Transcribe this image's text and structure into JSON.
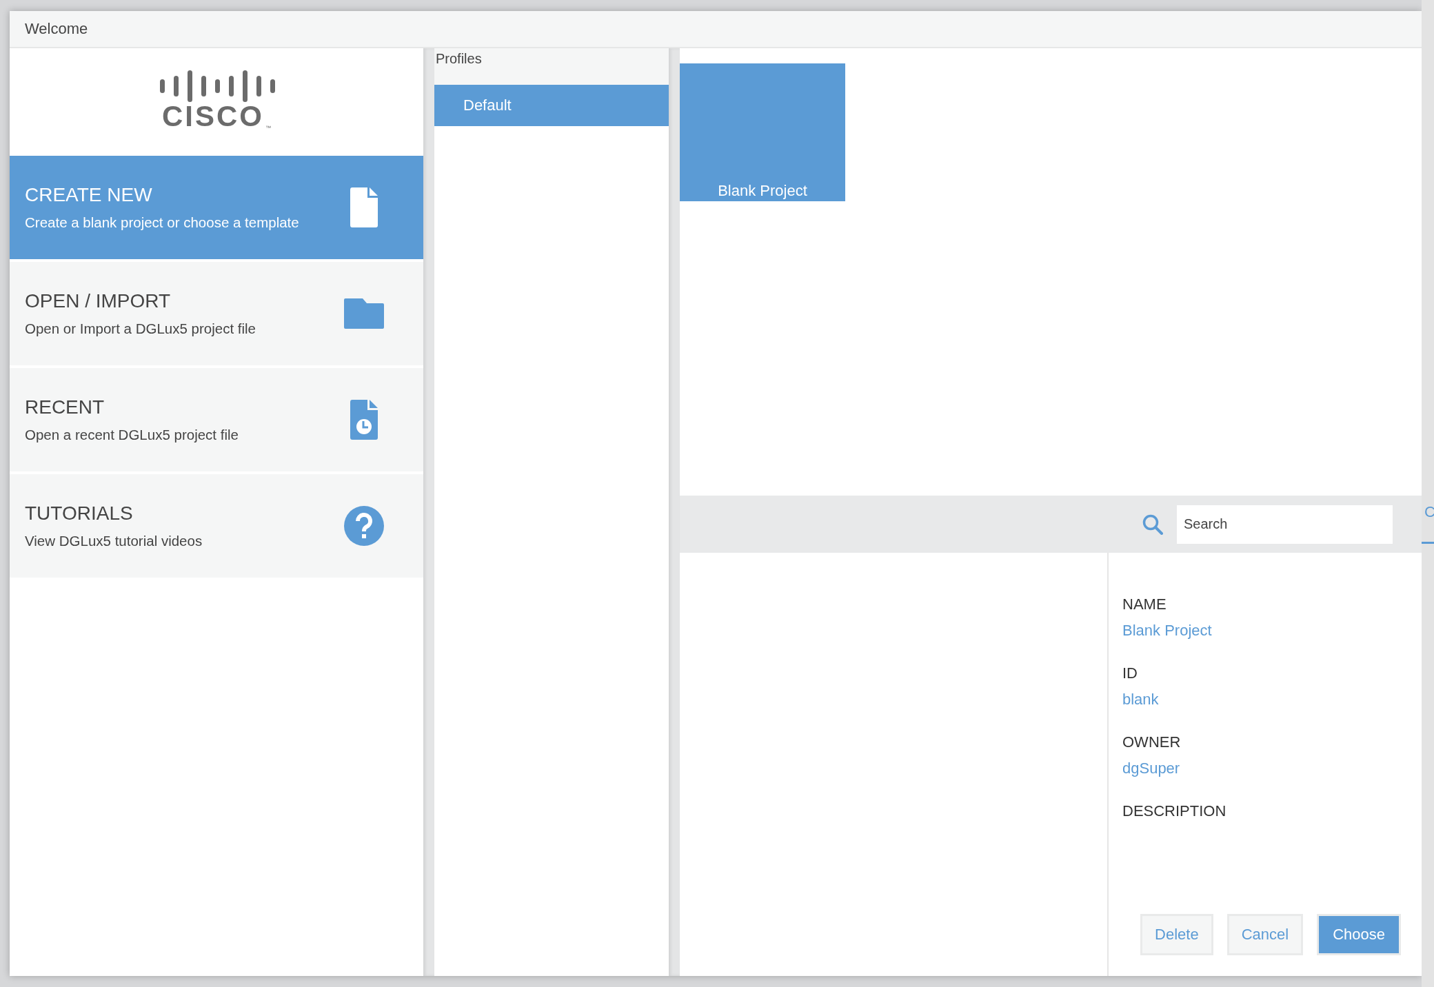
{
  "window": {
    "title": "Welcome"
  },
  "logo": {
    "wordmark": "CISCO",
    "trademark": "™"
  },
  "actions": [
    {
      "kind": "create",
      "title": "CREATE NEW",
      "subtitle": "Create a blank project or choose a template",
      "selected": true
    },
    {
      "kind": "open",
      "title": "OPEN / IMPORT",
      "subtitle": "Open or Import a DGLux5 project file",
      "selected": false
    },
    {
      "kind": "recent",
      "title": "RECENT",
      "subtitle": "Open a recent DGLux5 project file",
      "selected": false
    },
    {
      "kind": "tutorials",
      "title": "TUTORIALS",
      "subtitle": "View DGLux5 tutorial videos",
      "selected": false
    }
  ],
  "profiles": {
    "heading": "Profiles",
    "items": [
      {
        "label": "Default",
        "selected": true
      }
    ]
  },
  "templates": [
    {
      "label": "Blank Project",
      "selected": true
    }
  ],
  "search": {
    "placeholder": "Search"
  },
  "details": [
    {
      "label": "NAME",
      "value": "Blank Project"
    },
    {
      "label": "ID",
      "value": "blank"
    },
    {
      "label": "OWNER",
      "value": "dgSuper"
    },
    {
      "label": "DESCRIPTION"
    }
  ],
  "buttons": [
    {
      "label": "Delete",
      "primary": false
    },
    {
      "label": "Cancel",
      "primary": false
    },
    {
      "label": "Choose",
      "primary": true
    }
  ],
  "side_panel": {
    "tab": "C"
  }
}
